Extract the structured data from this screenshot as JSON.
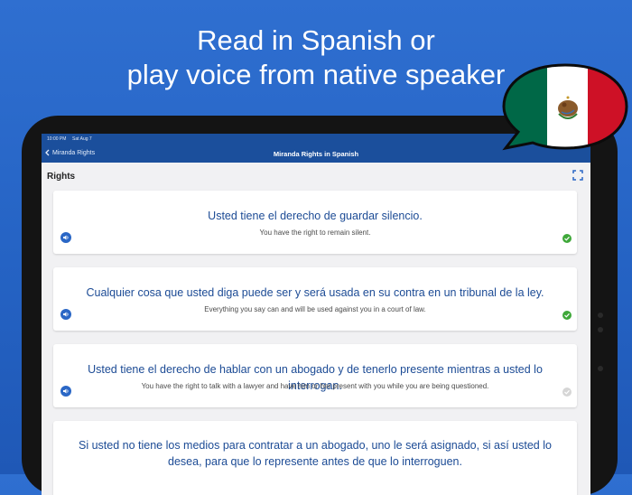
{
  "headline": {
    "line1": "Read in Spanish or",
    "line2": "play voice from native speaker"
  },
  "status_bar": {
    "time": "10:00 PM",
    "date": "Sat Aug 7"
  },
  "navbar": {
    "back_label": "Miranda Rights",
    "title": "Miranda Rights in Spanish"
  },
  "section": {
    "title": "Rights"
  },
  "rights": [
    {
      "spanish": "Usted tiene el derecho de guardar silencio.",
      "english": "You have the right to remain silent.",
      "understood": true
    },
    {
      "spanish": "Cualquier cosa que usted diga puede ser y será usada en su contra en un tribunal de la ley.",
      "english": "Everything you say can and will be used against you in a court of law.",
      "understood": true
    },
    {
      "spanish": "Usted tiene el derecho de hablar con un abogado y de tenerlo presente mientras a usted lo interrogan.",
      "english": "You have the right to talk with a lawyer and have him or her present with you while you are being questioned.",
      "understood": false
    },
    {
      "spanish": "Si usted no tiene los medios para contratar a un abogado, uno le será asignado, si así usted lo desea, para que lo represente antes de que lo interroguen.",
      "english": "",
      "understood": false
    }
  ],
  "colors": {
    "background": "#2563c4",
    "navbar": "#1b4f9c",
    "spanish_text": "#1c4b95",
    "check_done": "#3fa83a",
    "check_pending": "#d6d6d6",
    "flag_green": "#006847",
    "flag_red": "#ce1126"
  },
  "icons": [
    "chevron-left-icon",
    "expand-icon",
    "speaker-icon",
    "checkmark-icon",
    "mexico-flag-icon"
  ]
}
